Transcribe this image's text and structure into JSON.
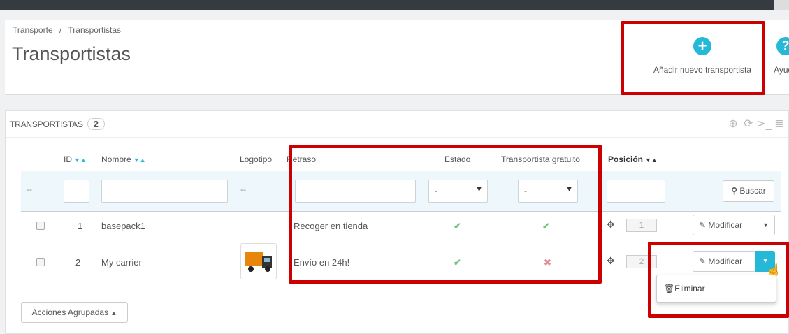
{
  "breadcrumb": [
    "Transporte",
    "/",
    "Transportistas"
  ],
  "page_title": "Transportistas",
  "toolbar": {
    "add_label": "Añadir nuevo transportista",
    "help_label": "Ayuda"
  },
  "panel": {
    "title": "TRANSPORTISTAS",
    "count": "2"
  },
  "columns": {
    "id": "ID",
    "name": "Nombre",
    "logo": "Logotipo",
    "delay": "Retraso",
    "status": "Estado",
    "free": "Transportista gratuito",
    "position": "Posición"
  },
  "filters": {
    "dash": "--",
    "status_value": "-",
    "free_value": "-",
    "search_label": "Buscar"
  },
  "rows": [
    {
      "id": "1",
      "name": "basepack1",
      "delay": "Recoger en tienda",
      "status": "✔",
      "free": "✔",
      "position": "1",
      "edit": "Modificar"
    },
    {
      "id": "2",
      "name": "My carrier",
      "delay": "Envío en 24h!",
      "status": "✔",
      "free": "✖",
      "position": "2",
      "edit": "Modificar"
    }
  ],
  "dropdown": {
    "delete_label": "Eliminar"
  },
  "bulk": {
    "label": "Acciones Agrupadas"
  },
  "colors": {
    "accent": "#25b9d7",
    "highlight": "#cc0000",
    "ok": "#72c279",
    "ko": "#e08f95"
  }
}
